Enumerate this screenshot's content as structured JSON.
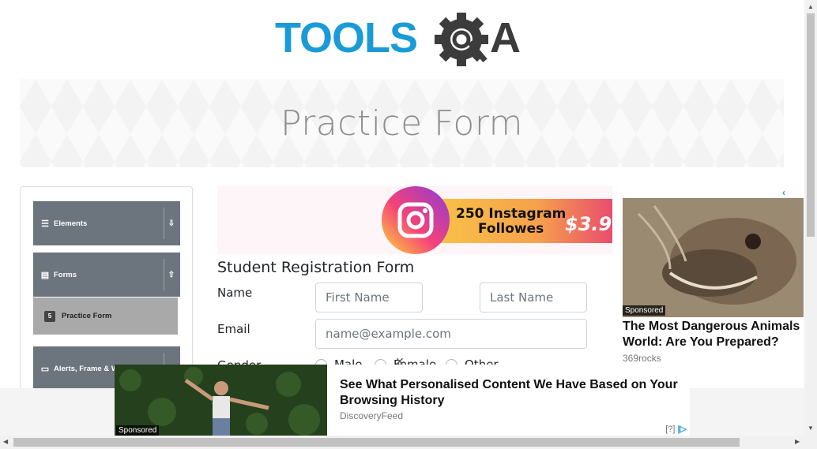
{
  "logo": {
    "text_tools": "TOOLS",
    "text_qa": "QA",
    "color_blue": "#1a9bd7",
    "color_dark": "#3c3c3c"
  },
  "banner": {
    "title": "Practice Form"
  },
  "sidebar": {
    "groups": [
      {
        "label": "Elements",
        "icon": "hamburger-icon",
        "arrow": "⇩"
      },
      {
        "label": "Forms",
        "icon": "file-icon",
        "arrow": "⇧"
      },
      {
        "label": "Alerts, Frame & Windows",
        "icon": "window-icon",
        "arrow": ""
      }
    ],
    "active_item": {
      "label": "Practice Form",
      "icon": "html5-icon"
    }
  },
  "instagram_ad": {
    "line1": "250 Instagram",
    "line2": "Followes",
    "price": "$3.9"
  },
  "form": {
    "title": "Student Registration Form",
    "name_label": "Name",
    "first_name_placeholder": "First Name",
    "last_name_placeholder": "Last Name",
    "email_label": "Email",
    "email_placeholder": "name@example.com",
    "gender_label": "Gender",
    "gender_options": [
      "Male",
      "Female",
      "Other"
    ]
  },
  "right_ad": {
    "sponsored": "Sponsored",
    "headline": "The Most Dangerous Animals World: Are You Prepared?",
    "source": "369rocks"
  },
  "bottom_ad": {
    "sponsored": "Sponsored",
    "headline": "See What Personalised Content We Have Based on Your Browsing History",
    "source": "DiscoveryFeed",
    "choices": "[?]"
  },
  "colors": {
    "sidebar_header": "#6c757d",
    "active_item": "#a9a9a9",
    "accent": "#1a9bd7"
  }
}
